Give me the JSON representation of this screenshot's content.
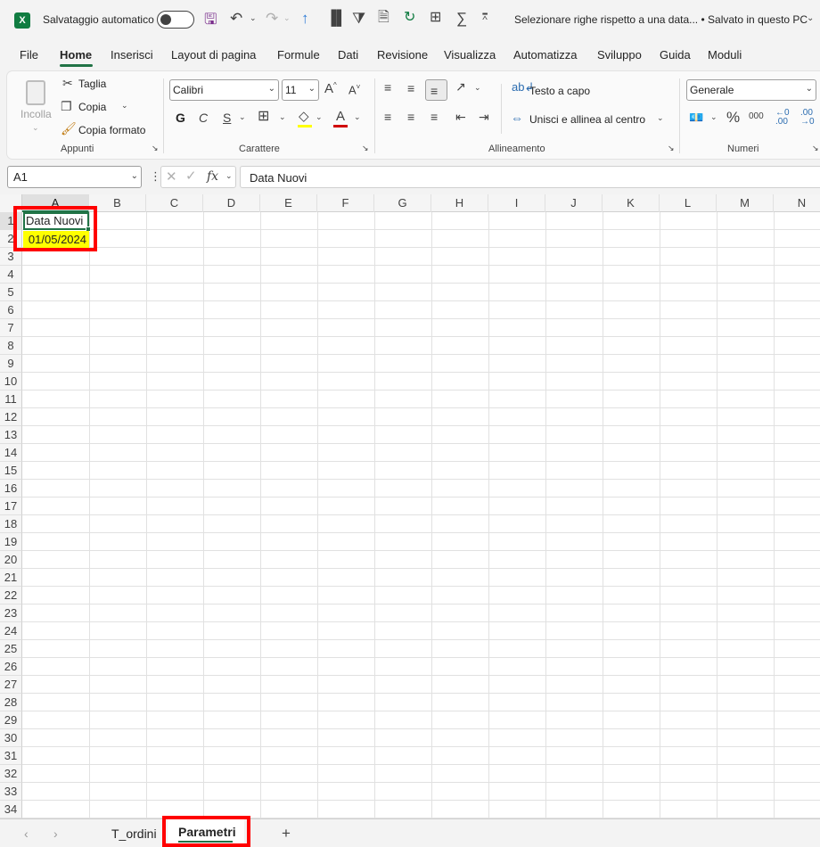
{
  "titlebar": {
    "autosave_label": "Salvataggio automatico",
    "doc_title": "Selezionare righe rispetto a una data...",
    "save_status": "Salvato in questo PC"
  },
  "ribbon_tabs": [
    "File",
    "Home",
    "Inserisci",
    "Layout di pagina",
    "Formule",
    "Dati",
    "Revisione",
    "Visualizza",
    "Automatizza",
    "Sviluppo",
    "Guida",
    "Moduli"
  ],
  "clipboard": {
    "paste": "Incolla",
    "cut": "Taglia",
    "copy": "Copia",
    "format_painter": "Copia formato",
    "group": "Appunti"
  },
  "font": {
    "name": "Calibri",
    "size": "11",
    "bold": "G",
    "italic": "C",
    "underline": "S",
    "font_color_letter": "A",
    "group": "Carattere"
  },
  "alignment": {
    "wrap_text": "Testo a capo",
    "merge_center": "Unisci e allinea al centro",
    "group": "Allineamento"
  },
  "number": {
    "format": "Generale",
    "percent": "%",
    "thousands": "000",
    "group": "Numeri"
  },
  "formula_bar": {
    "name_box": "A1",
    "fx": "fx",
    "content": "Data Nuovi"
  },
  "columns": [
    "A",
    "B",
    "C",
    "D",
    "E",
    "F",
    "G",
    "H",
    "I",
    "J",
    "K",
    "L",
    "M",
    "N"
  ],
  "rows": [
    "1",
    "2",
    "3",
    "4",
    "5",
    "6",
    "7",
    "8",
    "9",
    "10",
    "11",
    "12",
    "13",
    "14",
    "15",
    "16",
    "17",
    "18",
    "19",
    "20",
    "21",
    "22",
    "23",
    "24",
    "25",
    "26",
    "27",
    "28",
    "29",
    "30",
    "31",
    "32",
    "33",
    "34"
  ],
  "cells": {
    "A1": "Data Nuovi",
    "A2": "01/05/2024"
  },
  "sheets": {
    "tab1": "T_ordini",
    "tab2": "Parametri",
    "add": "+"
  },
  "colors": {
    "accent": "#217346",
    "highlight_fill": "#ffff00",
    "annotation": "#ff0000"
  }
}
